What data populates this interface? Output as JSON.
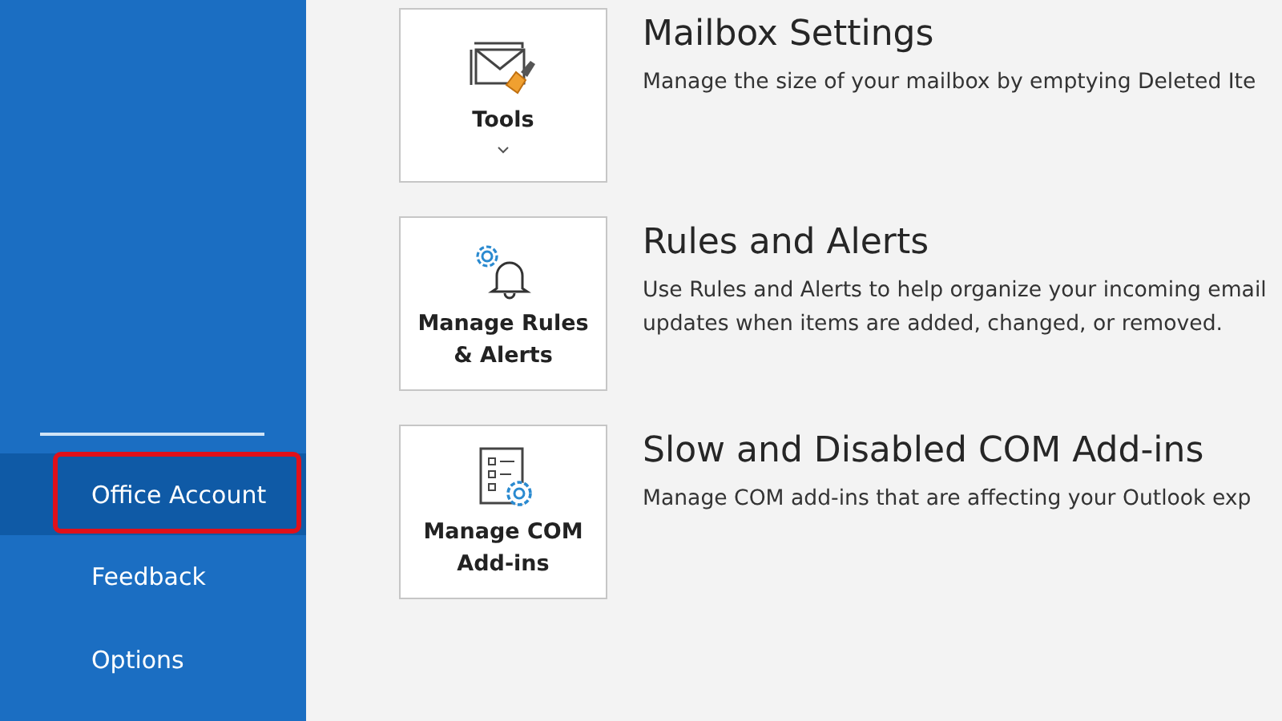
{
  "sidebar": {
    "items": [
      {
        "label": "Office Account",
        "selected": true,
        "highlighted": true
      },
      {
        "label": "Feedback",
        "selected": false,
        "highlighted": false
      },
      {
        "label": "Options",
        "selected": false,
        "highlighted": false
      }
    ]
  },
  "sections": [
    {
      "kind": "tools",
      "button": [
        "Tools"
      ],
      "dropdown": true,
      "title": "Mailbox Settings",
      "description": [
        "Manage the size of your mailbox by emptying Deleted Ite"
      ]
    },
    {
      "kind": "rules",
      "button": [
        "Manage Rules",
        "& Alerts"
      ],
      "dropdown": false,
      "title": "Rules and Alerts",
      "description": [
        "Use Rules and Alerts to help organize your incoming email",
        "updates when items are added, changed, or removed."
      ]
    },
    {
      "kind": "addins",
      "button": [
        "Manage COM",
        "Add-ins"
      ],
      "dropdown": false,
      "title": "Slow and Disabled COM Add-ins",
      "description": [
        "Manage COM add-ins that are affecting your Outlook exp"
      ]
    }
  ]
}
